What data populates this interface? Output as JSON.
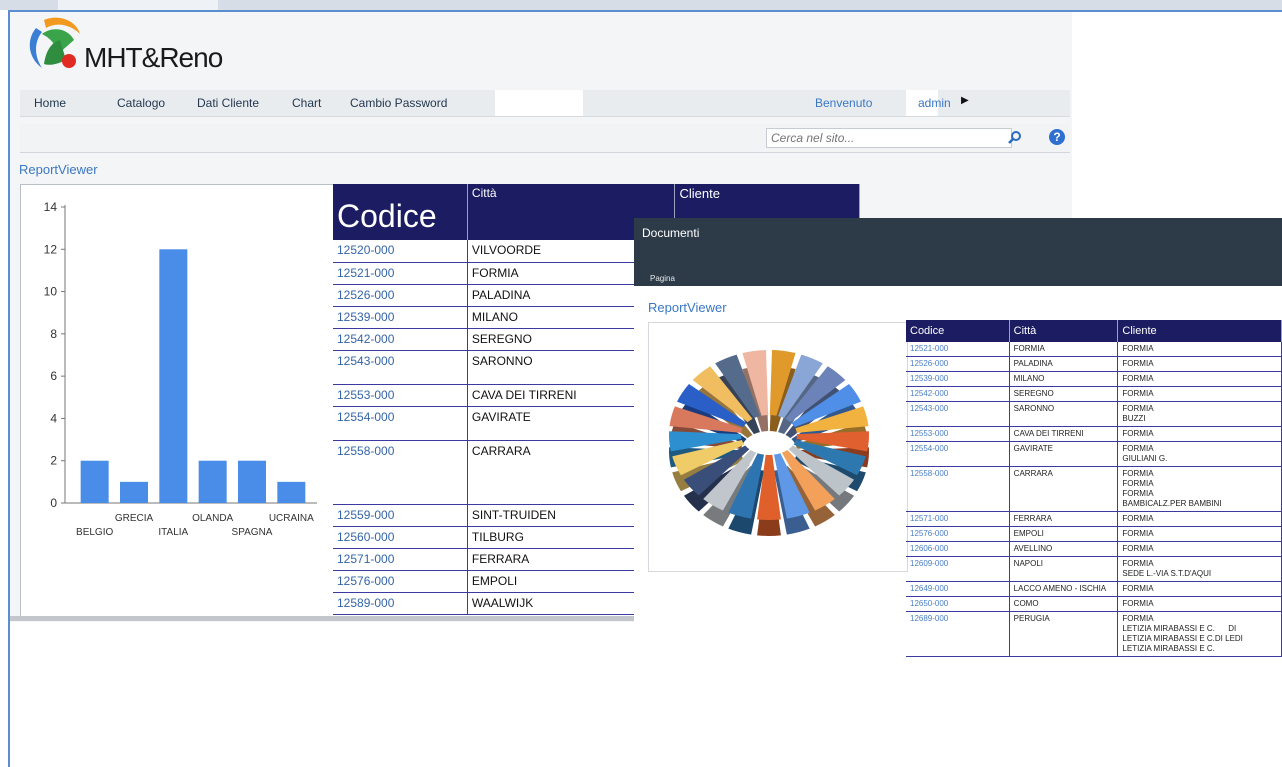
{
  "app": {
    "logo_text": "MHT&Reno",
    "nav": [
      "Home",
      "Catalogo",
      "Dati Cliente",
      "Chart",
      "Cambio Password"
    ],
    "welcome": "Benvenuto",
    "user": "admin",
    "search_placeholder": "Cerca nel sito..."
  },
  "left_section": {
    "title": "ReportViewer",
    "chart_data": {
      "type": "bar",
      "categories": [
        "BELGIO",
        "GRECIA",
        "ITALIA",
        "OLANDA",
        "SPAGNA",
        "UCRAINA"
      ],
      "values": [
        2,
        1,
        12,
        2,
        2,
        1
      ],
      "ylim": [
        0,
        14
      ],
      "yticks": [
        0,
        2,
        4,
        6,
        8,
        10,
        12,
        14
      ],
      "bar_color": "#4a8de8",
      "grid": false
    }
  },
  "back_table": {
    "headers": [
      "Codice",
      "Città",
      "Cliente"
    ],
    "rows": [
      {
        "code": "12520-000",
        "city": "VILVOORDE"
      },
      {
        "code": "12521-000",
        "city": "FORMIA"
      },
      {
        "code": "12526-000",
        "city": "PALADINA"
      },
      {
        "code": "12539-000",
        "city": "MILANO"
      },
      {
        "code": "12542-000",
        "city": "SEREGNO"
      },
      {
        "code": "12543-000",
        "city": "SARONNO"
      },
      {
        "code": "12553-000",
        "city": "CAVA DEI TIRRENI"
      },
      {
        "code": "12554-000",
        "city": "GAVIRATE"
      },
      {
        "code": "12558-000",
        "city": "CARRARA"
      },
      {
        "code": "12559-000",
        "city": "SINT-TRUIDEN"
      },
      {
        "code": "12560-000",
        "city": "TILBURG"
      },
      {
        "code": "12571-000",
        "city": "FERRARA"
      },
      {
        "code": "12576-000",
        "city": "EMPOLI"
      },
      {
        "code": "12589-000",
        "city": "WAALWIJK"
      }
    ]
  },
  "overlay": {
    "header": "Documenti",
    "sub": "Pagina",
    "title": "ReportViewer",
    "pie_colors": [
      "#e09a2c",
      "#8aa6d6",
      "#6b83b8",
      "#4f8fe8",
      "#f2b240",
      "#e06030",
      "#2e78b0",
      "#bcc3c9",
      "#f2a05a",
      "#5e98e6",
      "#e0602c",
      "#2e74b0",
      "#c0c6cc",
      "#3a4e7a",
      "#f0cc68",
      "#2e8fd0",
      "#d8785c",
      "#2a5fc8",
      "#f0bd60",
      "#556b8c",
      "#efb7a2"
    ],
    "table": {
      "headers": [
        "Codice",
        "Città",
        "Cliente"
      ],
      "rows": [
        {
          "code": "12521-000",
          "city": "FORMIA",
          "client": "FORMIA"
        },
        {
          "code": "12526-000",
          "city": "PALADINA",
          "client": "FORMIA"
        },
        {
          "code": "12539-000",
          "city": "MILANO",
          "client": "FORMIA"
        },
        {
          "code": "12542-000",
          "city": "SEREGNO",
          "client": "FORMIA"
        },
        {
          "code": "12543-000",
          "city": "SARONNO",
          "client": "FORMIA\nBUZZI"
        },
        {
          "code": "12553-000",
          "city": "CAVA DEI TIRRENI",
          "client": "FORMIA"
        },
        {
          "code": "12554-000",
          "city": "GAVIRATE",
          "client": "FORMIA\nGIULIANI G."
        },
        {
          "code": "12558-000",
          "city": "CARRARA",
          "client": "FORMIA\nFORMIA\nFORMIA\nBAMBICALZ.PER BAMBINI"
        },
        {
          "code": "12571-000",
          "city": "FERRARA",
          "client": "FORMIA"
        },
        {
          "code": "12576-000",
          "city": "EMPOLI",
          "client": "FORMIA"
        },
        {
          "code": "12606-000",
          "city": "AVELLINO",
          "client": "FORMIA"
        },
        {
          "code": "12609-000",
          "city": "NAPOLI",
          "client": "FORMIA\nSEDE L.-VIA S.T.D'AQUI"
        },
        {
          "code": "12649-000",
          "city": "LACCO AMENO - ISCHIA",
          "client": "FORMIA"
        },
        {
          "code": "12650-000",
          "city": "COMO",
          "client": "FORMIA"
        },
        {
          "code": "12689-000",
          "city": "PERUGIA",
          "client": "FORMIA\nLETIZIA MIRABASSI E C.      DI\nLETIZIA MIRABASSI E C.DI LEDI\nLETIZIA MIRABASSI E C."
        }
      ]
    }
  }
}
